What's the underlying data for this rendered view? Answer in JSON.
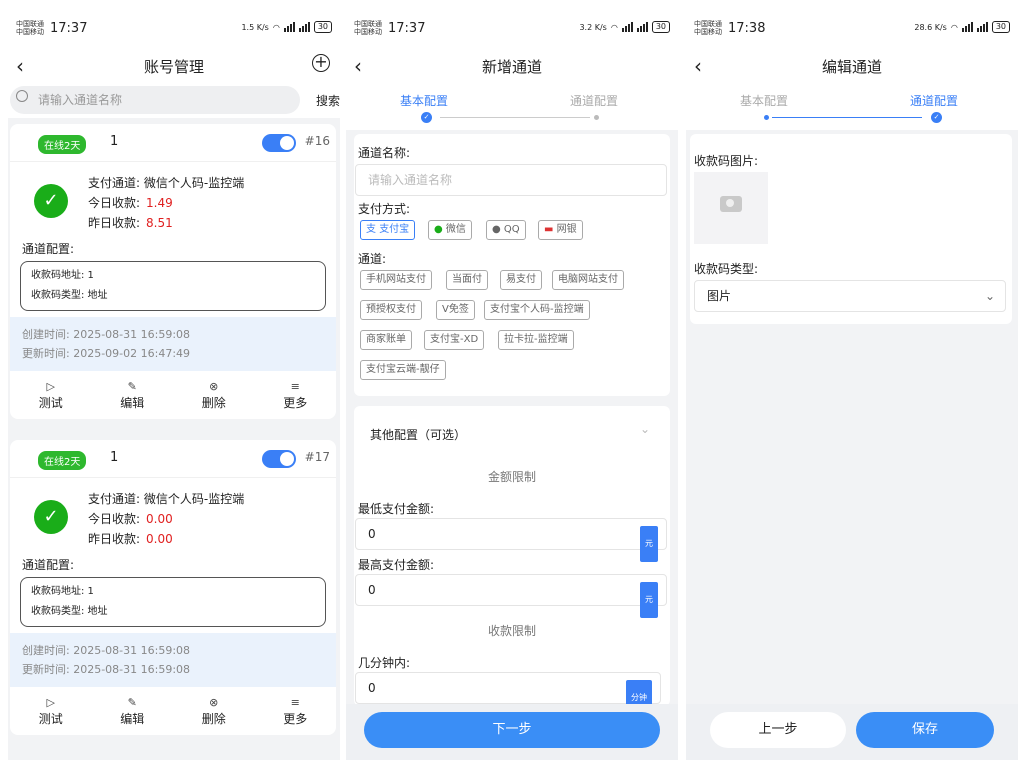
{
  "status": {
    "carrier1": "中国联通",
    "carrier2": "中国移动",
    "s1_time": "17:37",
    "s2_time": "17:37",
    "s3_time": "17:38",
    "s1_speed": "1.5 K/s",
    "s2_speed": "3.2 K/s",
    "s3_speed": "28.6 K/s",
    "battery": "30"
  },
  "screen1": {
    "title": "账号管理",
    "search_placeholder": "请输入通道名称",
    "search_button": "搜索",
    "cards": [
      {
        "badge": "在线2天",
        "num": "1",
        "id": "#16",
        "channel_label": "支付通道:",
        "channel_value": "微信个人码-监控端",
        "today_label": "今日收款:",
        "today_value": "1.49",
        "yesterday_label": "昨日收款:",
        "yesterday_value": "8.51",
        "config_title": "通道配置:",
        "config_line1": "收款码地址: 1",
        "config_line2": "收款码类型: 地址",
        "created": "创建时间:  2025-08-31 16:59:08",
        "updated": "更新时间:  2025-09-02 16:47:49"
      },
      {
        "badge": "在线2天",
        "num": "1",
        "id": "#17",
        "channel_label": "支付通道:",
        "channel_value": "微信个人码-监控端",
        "today_label": "今日收款:",
        "today_value": "0.00",
        "yesterday_label": "昨日收款:",
        "yesterday_value": "0.00",
        "config_title": "通道配置:",
        "config_line1": "收款码地址: 1",
        "config_line2": "收款码类型: 地址",
        "created": "创建时间:  2025-08-31 16:59:08",
        "updated": "更新时间:  2025-08-31 16:59:08"
      }
    ],
    "actions": {
      "test": "测试",
      "edit": "编辑",
      "delete": "删除",
      "more": "更多"
    }
  },
  "screen2": {
    "title": "新增通道",
    "step1": "基本配置",
    "step2": "通道配置",
    "name_label": "通道名称:",
    "name_placeholder": "请输入通道名称",
    "pay_label": "支付方式:",
    "pay_methods": [
      "支付宝",
      "微信",
      "QQ",
      "网银"
    ],
    "channel_label": "通道:",
    "channels": [
      "手机网站支付",
      "当面付",
      "易支付",
      "电脑网站支付",
      "预授权支付",
      "V免签",
      "支付宝个人码-监控端",
      "商家账单",
      "支付宝-XD",
      "拉卡拉-监控端",
      "支付宝云端-靓仔"
    ],
    "other_title": "其他配置（可选）",
    "amount_limit": "金额限制",
    "min_label": "最低支付金额:",
    "min_value": "0",
    "max_label": "最高支付金额:",
    "max_value": "0",
    "unit_yuan": "元",
    "receive_limit": "收款限制",
    "minutes_label": "几分钟内:",
    "minutes_value": "0",
    "unit_min": "分钟",
    "next_button": "下一步"
  },
  "screen3": {
    "title": "编辑通道",
    "step1": "基本配置",
    "step2": "通道配置",
    "image_label": "收款码图片:",
    "type_label": "收款码类型:",
    "type_value": "图片",
    "prev_button": "上一步",
    "save_button": "保存"
  },
  "colors": {
    "accent": "#3a7ff6",
    "online": "#2eb82e",
    "amount": "#e02020"
  }
}
